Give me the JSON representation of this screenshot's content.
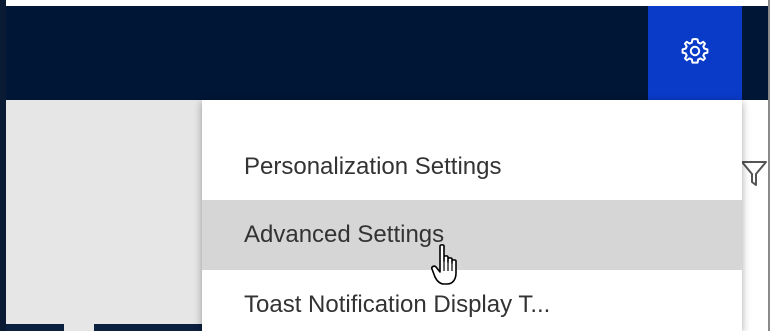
{
  "header": {
    "settings_icon": "gear-icon",
    "settings_button_color": "#0a3ac8",
    "background_color": "#001636"
  },
  "toolbar": {
    "filter_icon": "filter-icon"
  },
  "settings_menu": {
    "items": [
      {
        "label": "Personalization Settings"
      },
      {
        "label": "Advanced Settings",
        "hovered": true
      },
      {
        "label": "Toast Notification Display T..."
      }
    ]
  },
  "pointer": {
    "icon": "hand-pointer-icon"
  }
}
